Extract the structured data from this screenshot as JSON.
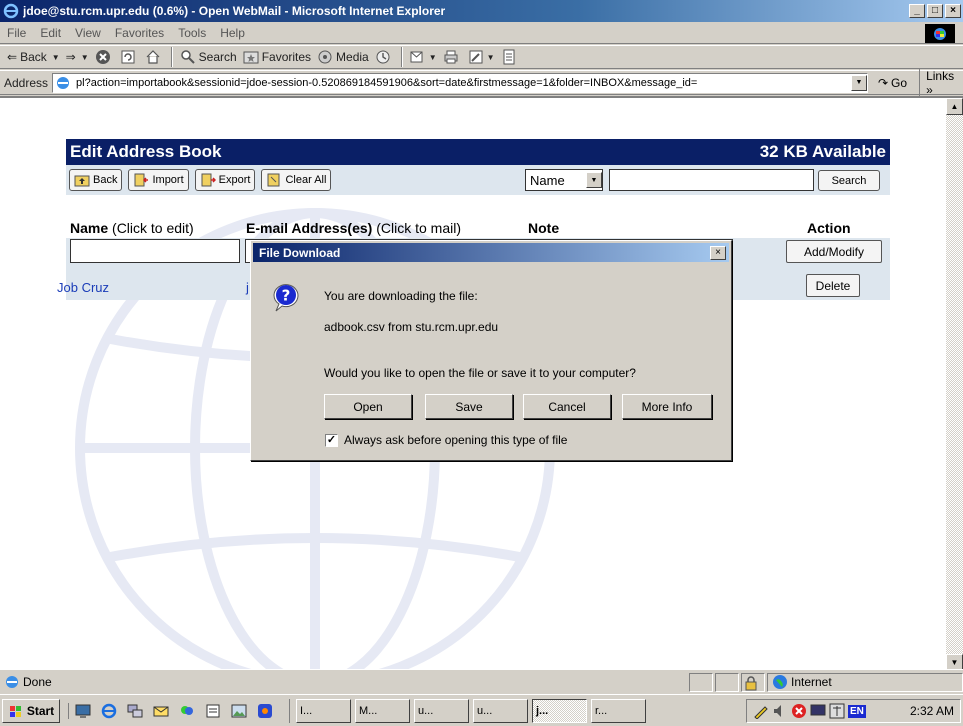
{
  "window": {
    "title": "jdoe@stu.rcm.upr.edu (0.6%) - Open WebMail - Microsoft Internet Explorer",
    "minimize": "_",
    "maximize": "□",
    "close": "×"
  },
  "menu": [
    "File",
    "Edit",
    "View",
    "Favorites",
    "Tools",
    "Help"
  ],
  "toolbar": {
    "back": "Back",
    "search": "Search",
    "favorites": "Favorites",
    "media": "Media"
  },
  "address": {
    "label": "Address",
    "url": "pl?action=importabook&sessionid=jdoe-session-0.520869184591906&sort=date&firstmessage=1&folder=INBOX&message_id=",
    "go": "Go",
    "links": "Links »"
  },
  "addressbook": {
    "title": "Edit Address Book",
    "available": "32 KB Available",
    "buttons": {
      "back": "Back",
      "import": "Import",
      "export": "Export",
      "clear_all": "Clear All",
      "search": "Search"
    },
    "search_field": {
      "selected": "Name"
    },
    "columns": {
      "name": "Name",
      "name_hint": "(Click to edit)",
      "email": "E-mail Address(es)",
      "email_hint": "(Click to mail)",
      "note": "Note",
      "action": "Action"
    },
    "add_modify": "Add/Modify",
    "entries": [
      {
        "name": "Job Cruz",
        "email_partial": "j",
        "action": "Delete"
      }
    ]
  },
  "dialog": {
    "title": "File Download",
    "line1": "You are downloading the file:",
    "line2": "adbook.csv from stu.rcm.upr.edu",
    "line3": "Would you like to open the file or save it to your computer?",
    "buttons": [
      "Open",
      "Save",
      "Cancel",
      "More Info"
    ],
    "checkbox_label": "Always ask before opening this type of file",
    "checkbox_checked": true
  },
  "status": {
    "text": "Done",
    "zone": "Internet"
  },
  "taskbar": {
    "start": "Start",
    "tasks": [
      "I...",
      "M...",
      "u...",
      "u...",
      "j...",
      "r..."
    ],
    "active_task_index": 4,
    "tray_lang": "EN",
    "clock": "2:32 AM"
  }
}
